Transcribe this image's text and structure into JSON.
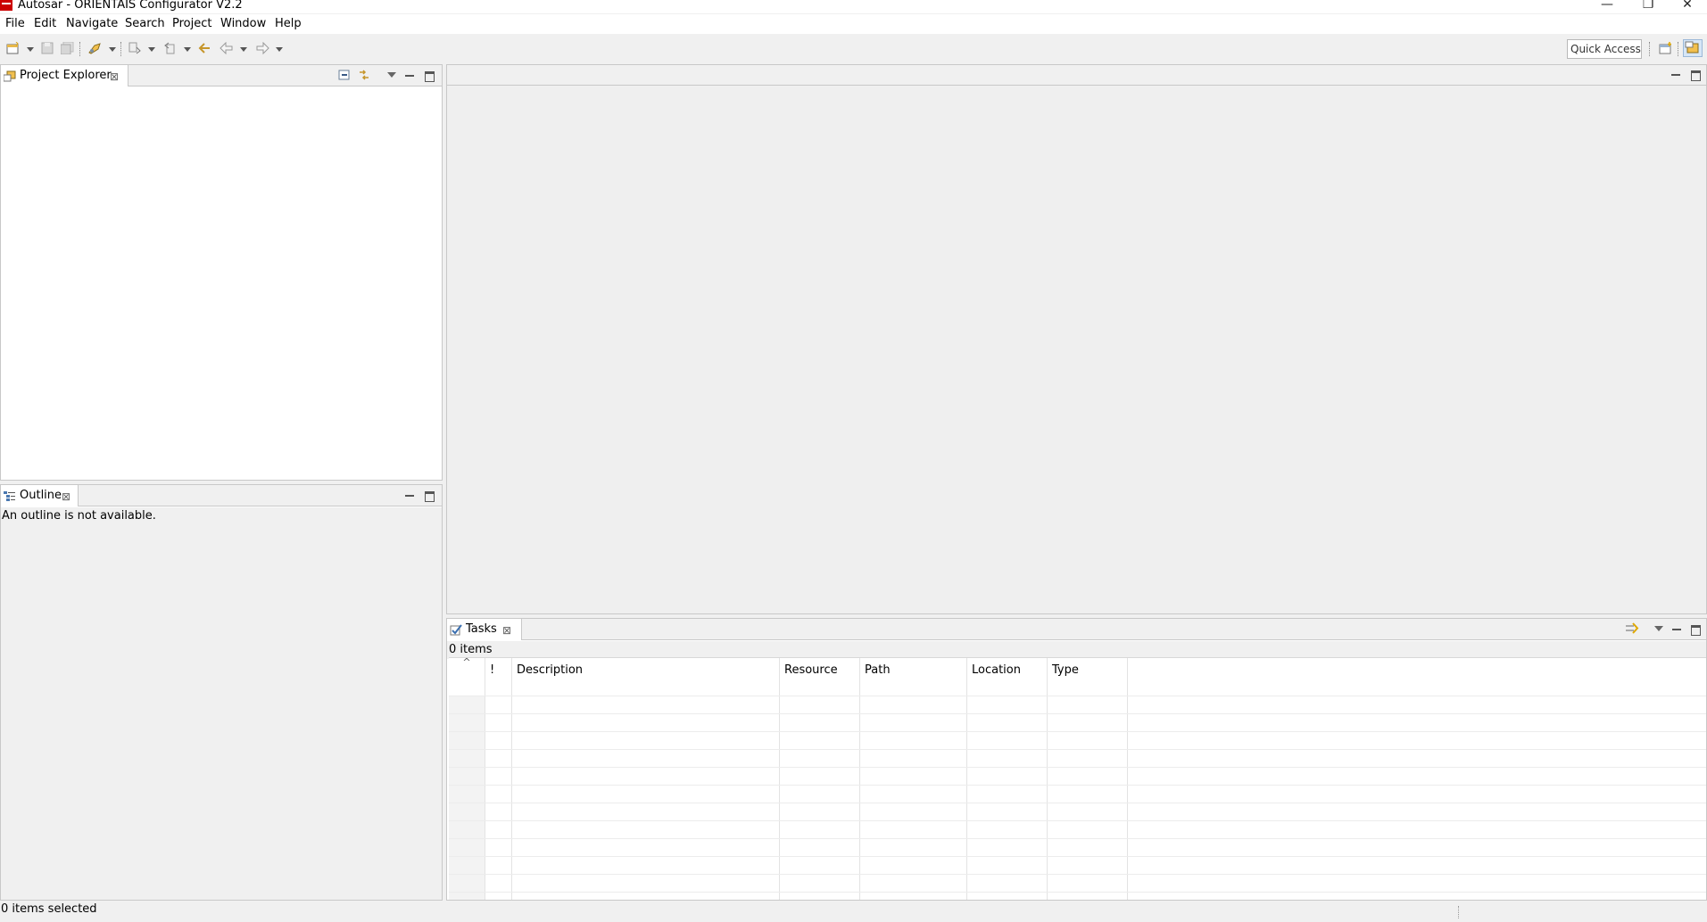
{
  "window": {
    "title": "Autosar - ORIENTAIS Configurator V2.2",
    "minimize_glyph": "—",
    "restore_glyph": "❐",
    "close_glyph": "✕"
  },
  "menubar": {
    "items": [
      "File",
      "Edit",
      "Navigate",
      "Search",
      "Project",
      "Window",
      "Help"
    ]
  },
  "toolbar": {
    "icons": [
      "new-wizard-icon",
      "save-icon",
      "save-all-icon",
      "run-icon",
      "next-annotation-icon",
      "previous-annotation-icon",
      "last-edit-location-icon",
      "back-icon",
      "forward-icon"
    ],
    "quick_access_label": "Quick Access",
    "perspective_icons": [
      "open-perspective-icon",
      "resource-perspective-icon"
    ]
  },
  "project_explorer": {
    "tab_label": "Project Explorer",
    "close_glyph": "⊠"
  },
  "outline": {
    "tab_label": "Outline",
    "close_glyph": "⊠",
    "message": "An outline is not available."
  },
  "tasks": {
    "tab_label": "Tasks",
    "close_glyph": "⊠",
    "item_count": "0 items",
    "sort_glyph": "^",
    "columns": [
      "!",
      "Description",
      "Resource",
      "Path",
      "Location",
      "Type"
    ]
  },
  "status": {
    "text": "0 items selected"
  },
  "colors": {
    "app_icon": "#cc0000",
    "panel_border": "#c8c8c8",
    "background": "#f0f0f0",
    "editor_area": "#efefef"
  }
}
